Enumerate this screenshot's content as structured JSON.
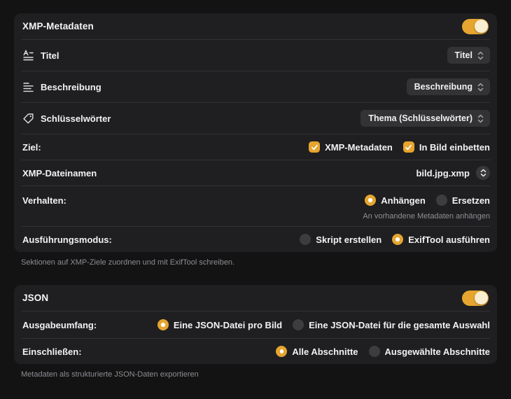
{
  "accent_color": "#e5a52f",
  "xmp": {
    "title": "XMP-Metadaten",
    "toggle_on": true,
    "rows": [
      {
        "icon": "textformat-icon",
        "label": "Titel",
        "value": "Titel"
      },
      {
        "icon": "text-align-icon",
        "label": "Beschreibung",
        "value": "Beschreibung"
      },
      {
        "icon": "tag-icon",
        "label": "Schlüsselwörter",
        "value": "Thema (Schlüsselwörter)"
      }
    ],
    "ziel": {
      "label": "Ziel:",
      "options": [
        {
          "label": "XMP-Metadaten",
          "checked": true
        },
        {
          "label": "In Bild einbetten",
          "checked": true
        }
      ]
    },
    "filename": {
      "label": "XMP-Dateinamen",
      "value": "bild.jpg.xmp"
    },
    "verhalten": {
      "label": "Verhalten:",
      "options": [
        "Anhängen",
        "Ersetzen"
      ],
      "selected_index": 0,
      "caption": "An vorhandene Metadaten anhängen"
    },
    "modus": {
      "label": "Ausführungsmodus:",
      "options": [
        "Skript erstellen",
        "ExifTool ausführen"
      ],
      "selected_index": 1
    },
    "footer": "Sektionen auf XMP-Ziele zuordnen und mit ExifTool schreiben."
  },
  "json": {
    "title": "JSON",
    "toggle_on": true,
    "umfang": {
      "label": "Ausgabeumfang:",
      "options": [
        "Eine JSON-Datei pro Bild",
        "Eine JSON-Datei für die gesamte Auswahl"
      ],
      "selected_index": 0
    },
    "einschliessen": {
      "label": "Einschließen:",
      "options": [
        "Alle Abschnitte",
        "Ausgewählte Abschnitte"
      ],
      "selected_index": 0
    },
    "footer": "Metadaten als strukturierte JSON-Daten exportieren"
  }
}
